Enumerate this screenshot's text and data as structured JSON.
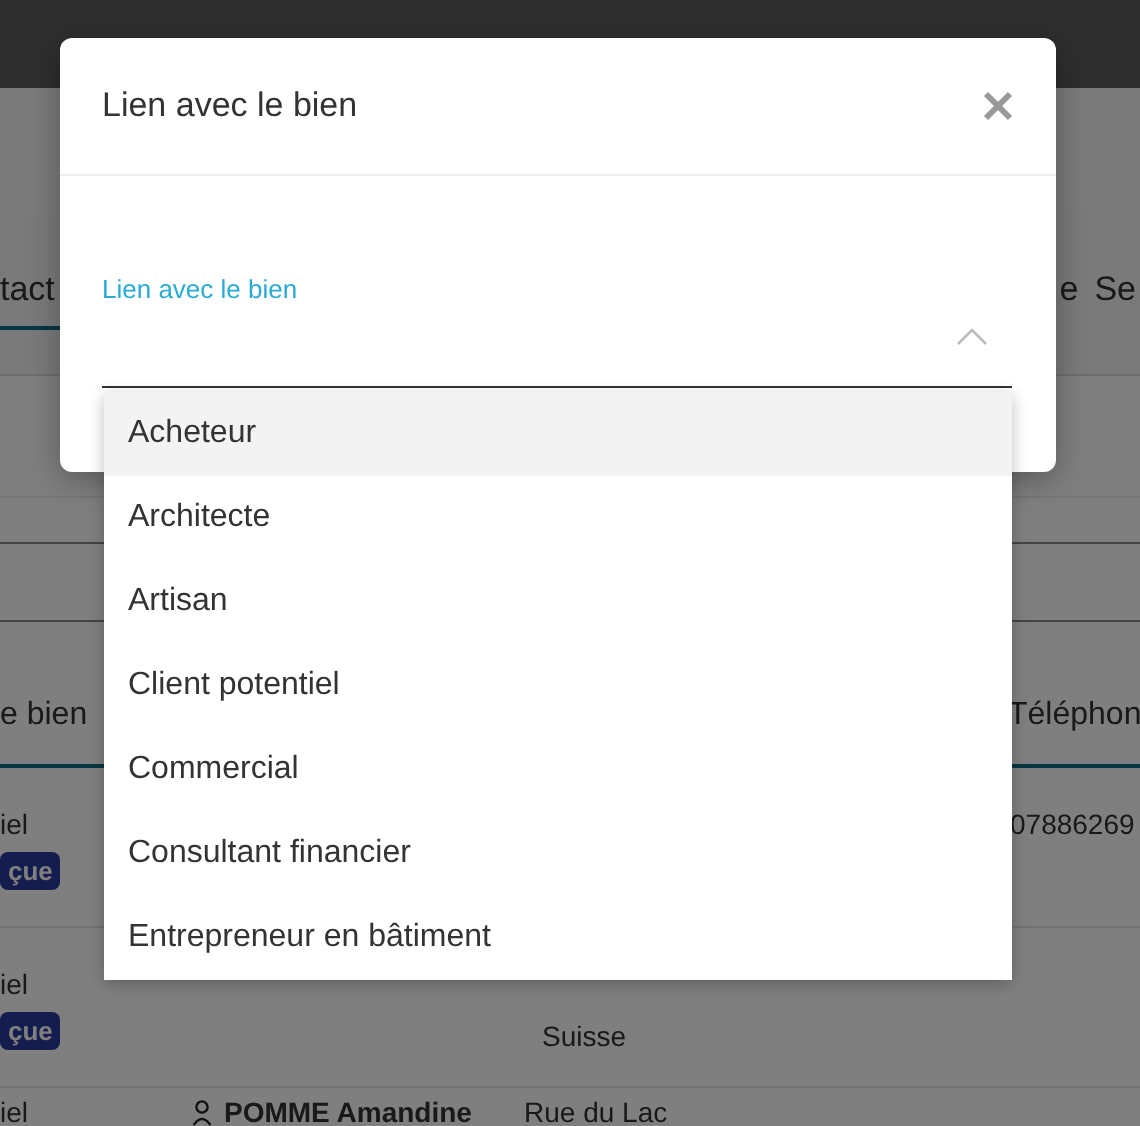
{
  "background": {
    "tabs": [
      {
        "label": "tact",
        "selected": true
      },
      {
        "label": "e",
        "selected": false
      },
      {
        "label": "Se",
        "selected": false
      }
    ],
    "table": {
      "columns": [
        "e bien",
        "Téléphon"
      ],
      "rows": [
        {
          "relation": "iel",
          "badge": "çue",
          "phone": "07886269"
        },
        {
          "relation": "iel",
          "badge": "çue",
          "address": "Suisse"
        },
        {
          "relation": "iel",
          "contact": "POMME Amandine",
          "address": "Rue du Lac"
        }
      ]
    }
  },
  "modal": {
    "title": "Lien avec le bien",
    "field": {
      "label": "Lien avec le bien",
      "expanded": true
    },
    "options": [
      {
        "label": "Acheteur",
        "selected": true
      },
      {
        "label": "Architecte",
        "selected": false
      },
      {
        "label": "Artisan",
        "selected": false
      },
      {
        "label": "Client potentiel",
        "selected": false
      },
      {
        "label": "Commercial",
        "selected": false
      },
      {
        "label": "Consultant financier",
        "selected": false
      },
      {
        "label": "Entrepreneur en bâtiment",
        "selected": false
      }
    ]
  }
}
